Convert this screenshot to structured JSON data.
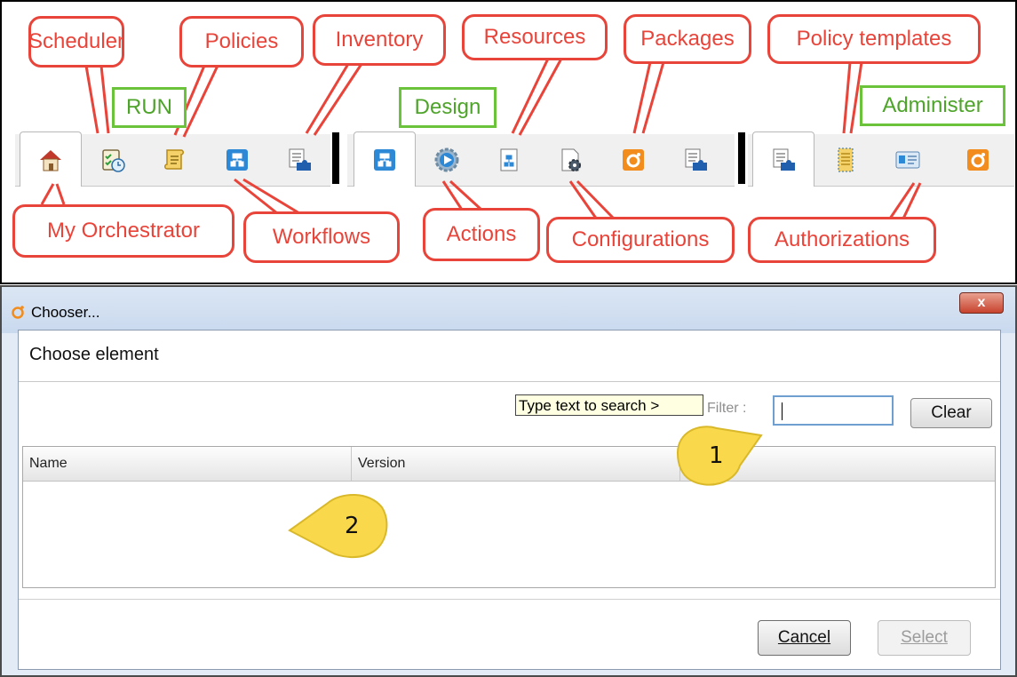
{
  "toolbar": {
    "groups": [
      {
        "label": "RUN"
      },
      {
        "label": "Design"
      },
      {
        "label": "Administer"
      }
    ],
    "callouts": {
      "scheduler": "Scheduler",
      "policies": "Policies",
      "inventory": "Inventory",
      "resources": "Resources",
      "packages": "Packages",
      "policy_templates": "Policy templates",
      "my_orchestrator": "My Orchestrator",
      "workflows": "Workflows",
      "actions": "Actions",
      "configurations": "Configurations",
      "authorizations": "Authorizations"
    },
    "colors": {
      "callout": "#e8443a",
      "group_label": "#6ac33a",
      "icon_blue": "#2d88d6",
      "icon_orange": "#f28c1c"
    }
  },
  "dialog": {
    "title": "Chooser...",
    "close_label": "x",
    "heading": "Choose element",
    "tooltip": "Type text to search >",
    "filter_label": "Filter :",
    "filter_value": "",
    "clear_label": "Clear",
    "columns": [
      "Name",
      "Version"
    ],
    "rows": [],
    "cancel_label": "Cancel",
    "select_label": "Select",
    "markers": {
      "filter": "1",
      "list": "2"
    }
  }
}
